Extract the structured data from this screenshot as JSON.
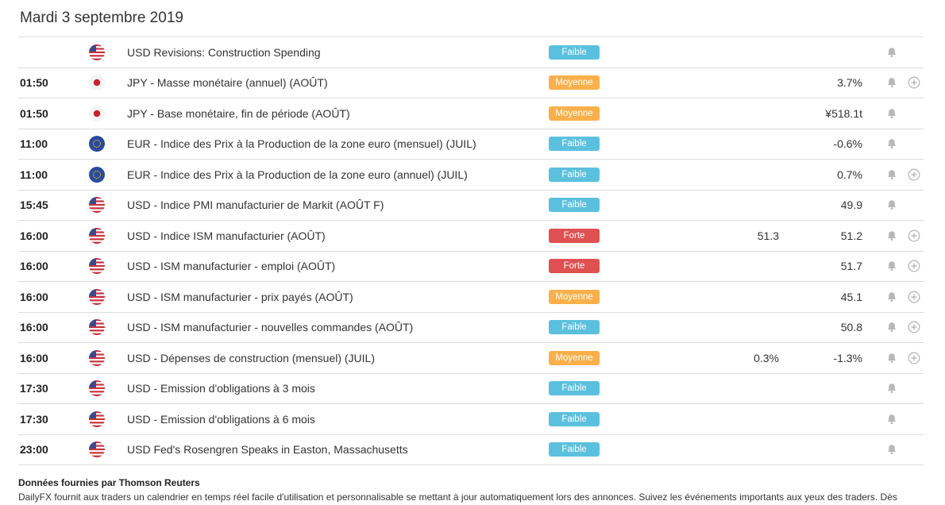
{
  "date_heading": "Mardi 3 septembre 2019",
  "colors": {
    "faible": "#5bc0de",
    "moyenne": "#f9b04a",
    "forte": "#e05050",
    "icon_gray": "#b8b8b8"
  },
  "rows": [
    {
      "time": "",
      "flag": "us-flag-icon",
      "event": "USD Revisions: Construction Spending",
      "importance": "Faible",
      "level": "faible",
      "forecast": "",
      "previous": "",
      "has_plus": false
    },
    {
      "time": "01:50",
      "flag": "jp-flag-icon",
      "event": "JPY - Masse monétaire (annuel) (AOÛT)",
      "importance": "Moyenne",
      "level": "moyenne",
      "forecast": "",
      "previous": "3.7%",
      "has_plus": true
    },
    {
      "time": "01:50",
      "flag": "jp-flag-icon",
      "event": "JPY - Base monétaire, fin de période (AOÛT)",
      "importance": "Moyenne",
      "level": "moyenne",
      "forecast": "",
      "previous": "¥518.1t",
      "has_plus": false
    },
    {
      "time": "11:00",
      "flag": "eu-flag-icon",
      "event": "EUR - Indice des Prix à la Production de la zone euro (mensuel) (JUIL)",
      "importance": "Faible",
      "level": "faible",
      "forecast": "",
      "previous": "-0.6%",
      "has_plus": false
    },
    {
      "time": "11:00",
      "flag": "eu-flag-icon",
      "event": "EUR - Indice des Prix à la Production de la zone euro (annuel) (JUIL)",
      "importance": "Faible",
      "level": "faible",
      "forecast": "",
      "previous": "0.7%",
      "has_plus": true
    },
    {
      "time": "15:45",
      "flag": "us-flag-icon",
      "event": "USD - Indice PMI manufacturier de Markit (AOÛT F)",
      "importance": "Faible",
      "level": "faible",
      "forecast": "",
      "previous": "49.9",
      "has_plus": false
    },
    {
      "time": "16:00",
      "flag": "us-flag-icon",
      "event": "USD - Indice ISM manufacturier (AOÛT)",
      "importance": "Forte",
      "level": "forte",
      "forecast": "51.3",
      "previous": "51.2",
      "has_plus": true
    },
    {
      "time": "16:00",
      "flag": "us-flag-icon",
      "event": "USD - ISM manufacturier - emploi (AOÛT)",
      "importance": "Forte",
      "level": "forte",
      "forecast": "",
      "previous": "51.7",
      "has_plus": true
    },
    {
      "time": "16:00",
      "flag": "us-flag-icon",
      "event": "USD - ISM manufacturier - prix payés (AOÛT)",
      "importance": "Moyenne",
      "level": "moyenne",
      "forecast": "",
      "previous": "45.1",
      "has_plus": true
    },
    {
      "time": "16:00",
      "flag": "us-flag-icon",
      "event": "USD - ISM manufacturier - nouvelles commandes (AOÛT)",
      "importance": "Faible",
      "level": "faible",
      "forecast": "",
      "previous": "50.8",
      "has_plus": true
    },
    {
      "time": "16:00",
      "flag": "us-flag-icon",
      "event": "USD - Dépenses de construction (mensuel) (JUIL)",
      "importance": "Moyenne",
      "level": "moyenne",
      "forecast": "0.3%",
      "previous": "-1.3%",
      "has_plus": true
    },
    {
      "time": "17:30",
      "flag": "us-flag-icon",
      "event": "USD - Emission d'obligations à 3 mois",
      "importance": "Faible",
      "level": "faible",
      "forecast": "",
      "previous": "",
      "has_plus": false
    },
    {
      "time": "17:30",
      "flag": "us-flag-icon",
      "event": "USD - Emission d'obligations à 6 mois",
      "importance": "Faible",
      "level": "faible",
      "forecast": "",
      "previous": "",
      "has_plus": false
    },
    {
      "time": "23:00",
      "flag": "us-flag-icon",
      "event": "USD Fed's Rosengren Speaks in Easton, Massachusetts",
      "importance": "Faible",
      "level": "faible",
      "forecast": "",
      "previous": "",
      "has_plus": false
    }
  ],
  "footer": {
    "title": "Données fournies par Thomson Reuters",
    "text": "DailyFX fournit aux traders un calendrier en temps réel facile d'utilisation et personnalisable se mettant à jour automatiquement lors des annonces. Suivez les événements importants aux yeux des traders. Dès"
  }
}
